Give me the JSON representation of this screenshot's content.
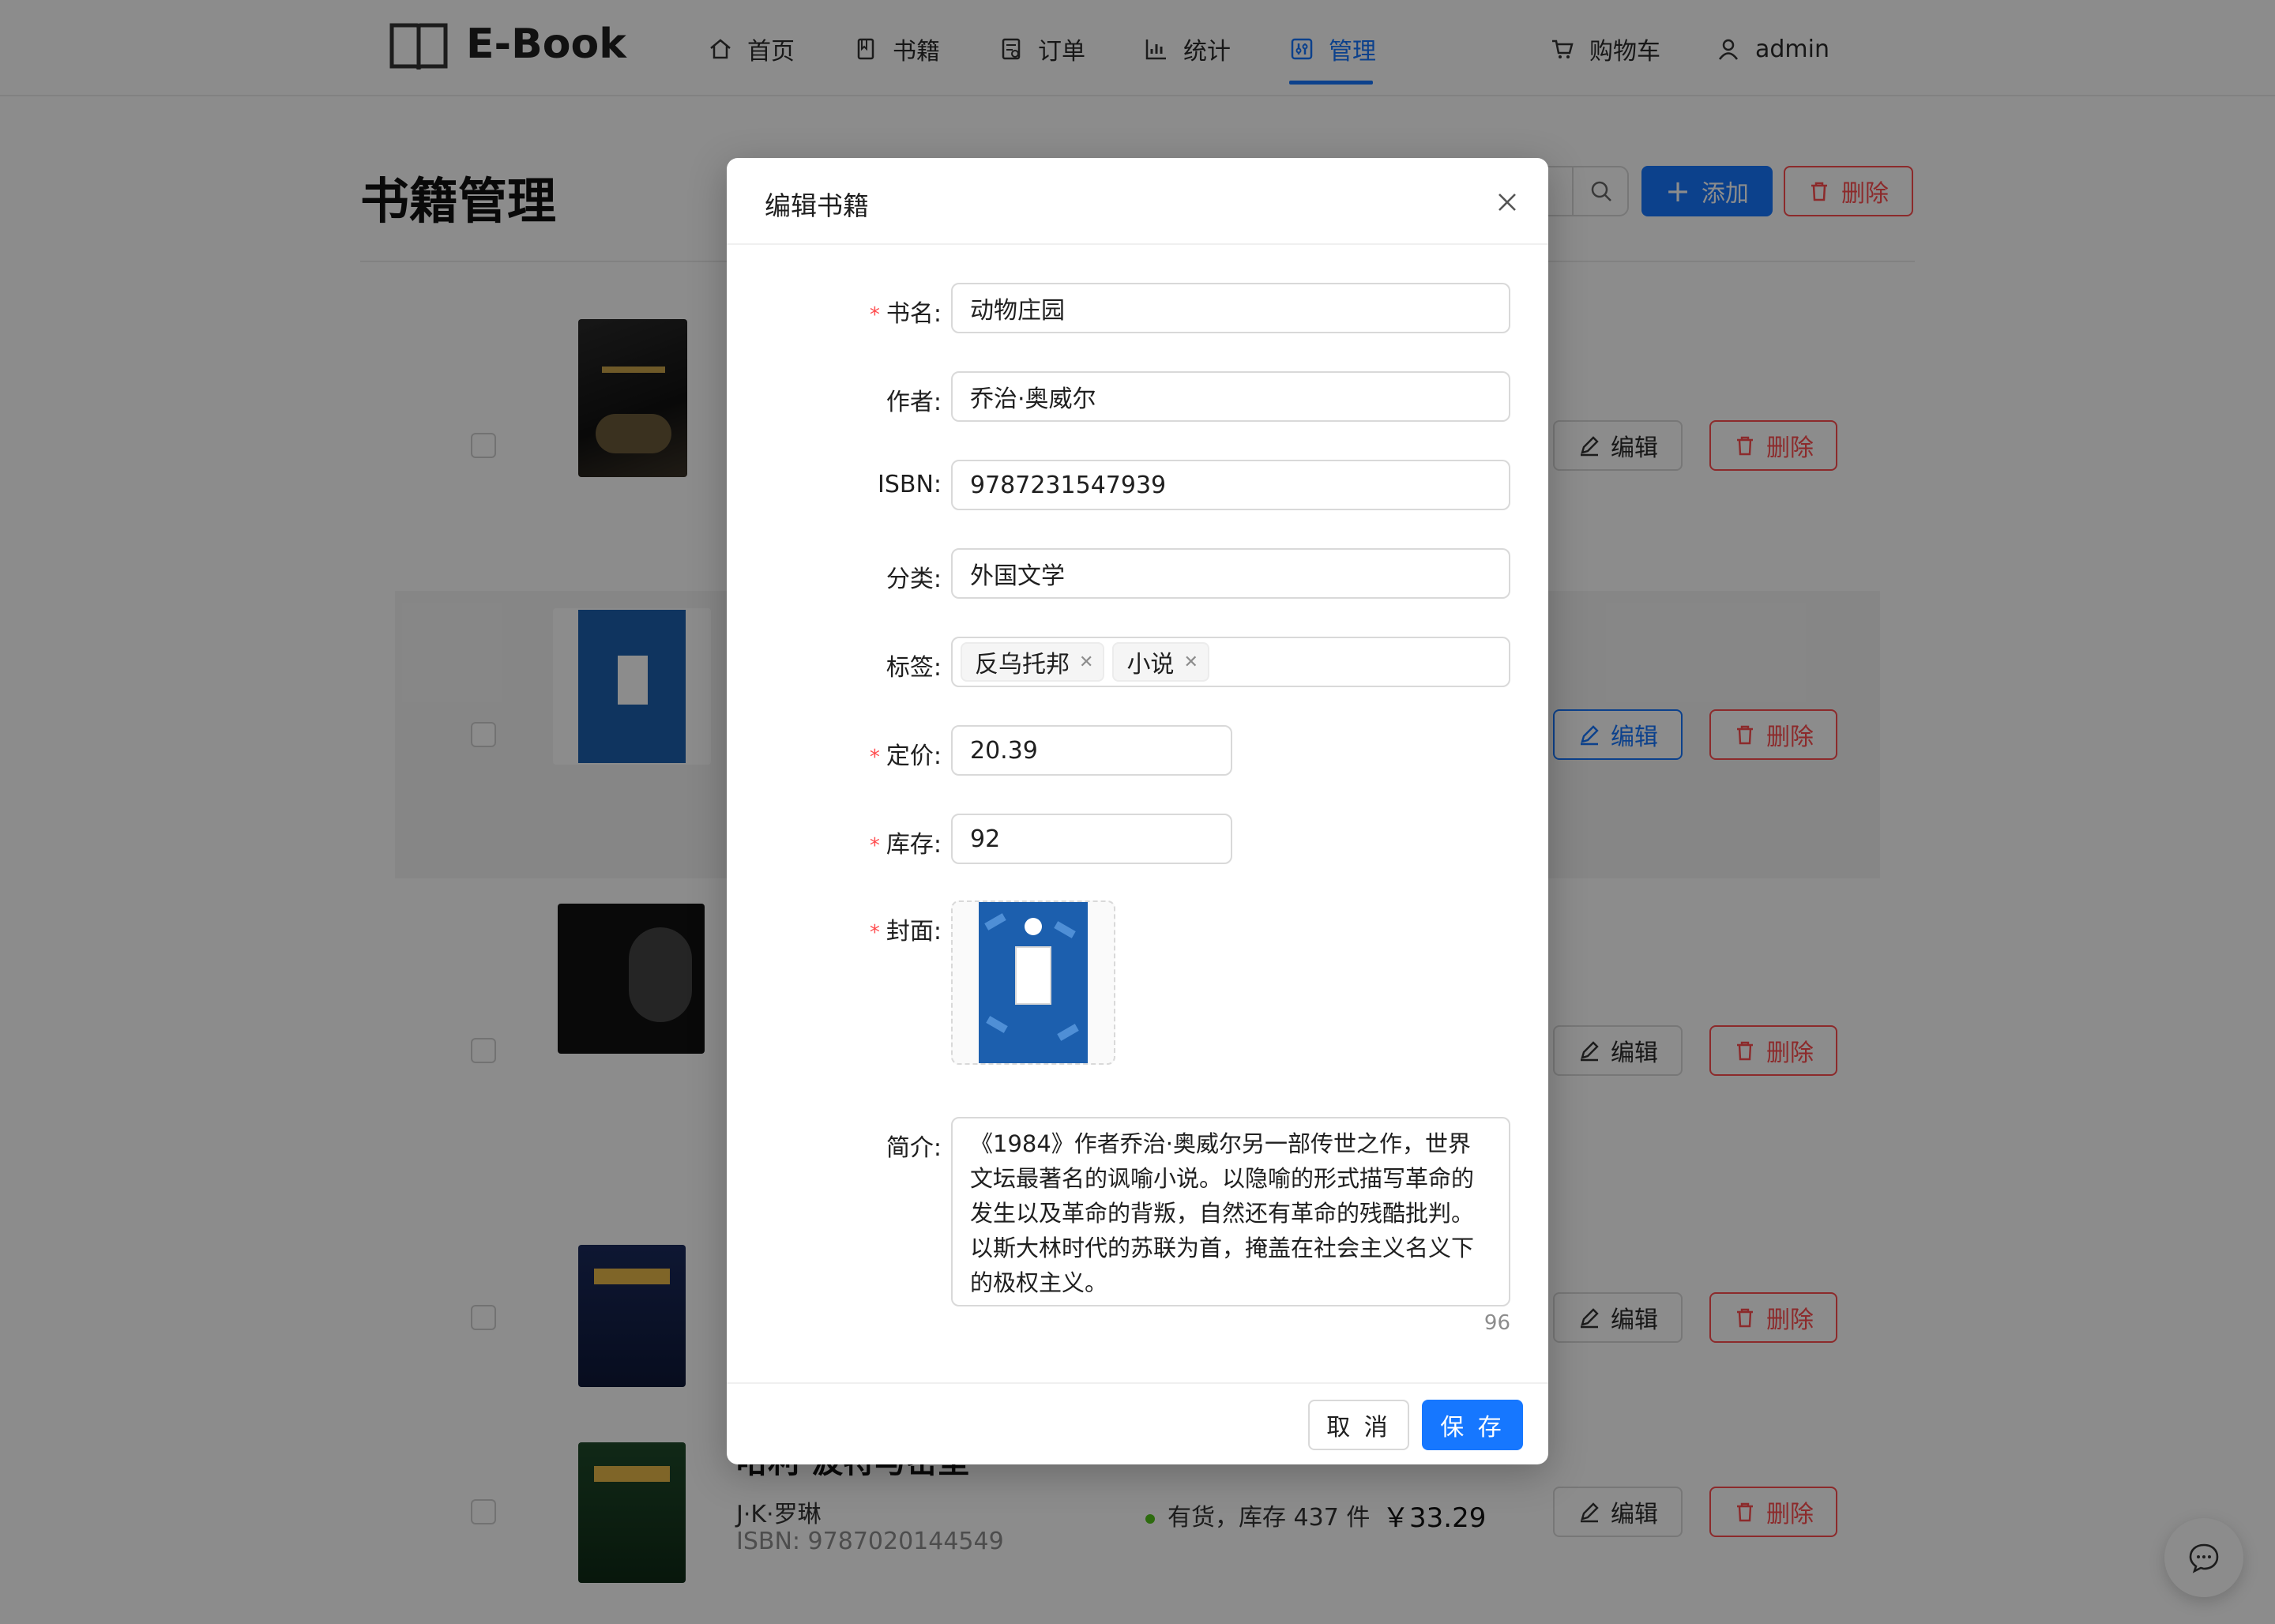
{
  "app": {
    "logo_text": "E-Book"
  },
  "nav": {
    "items": [
      {
        "label": "首页",
        "icon": "home-icon"
      },
      {
        "label": "书籍",
        "icon": "book-icon"
      },
      {
        "label": "订单",
        "icon": "order-icon"
      },
      {
        "label": "统计",
        "icon": "chart-icon"
      },
      {
        "label": "管理",
        "icon": "manage-icon",
        "active": true
      }
    ],
    "cart_label": "购物车",
    "user_label": "admin"
  },
  "page": {
    "title": "书籍管理",
    "add_label": "添加",
    "delete_label": "删除"
  },
  "rows": [
    {
      "edit_label": "编辑",
      "delete_label": "删除"
    },
    {
      "edit_label": "编辑",
      "delete_label": "删除",
      "highlighted": true
    },
    {
      "edit_label": "编辑",
      "delete_label": "删除"
    },
    {
      "edit_label": "编辑",
      "delete_label": "删除"
    },
    {
      "title": "哈利·波特与密室",
      "author": "J·K·罗琳",
      "isbn": "ISBN: 9787020144549",
      "status": "有货，库存 437 件",
      "price": "￥33.29",
      "edit_label": "编辑",
      "delete_label": "删除"
    }
  ],
  "modal": {
    "title": "编辑书籍",
    "fields": {
      "name_label": "书名:",
      "name_value": "动物庄园",
      "author_label": "作者:",
      "author_value": "乔治·奥威尔",
      "isbn_label": "ISBN:",
      "isbn_value": "9787231547939",
      "category_label": "分类:",
      "category_value": "外国文学",
      "tags_label": "标签:",
      "tags": [
        "反乌托邦",
        "小说"
      ],
      "price_label": "定价:",
      "price_value": "20.39",
      "stock_label": "库存:",
      "stock_value": "92",
      "cover_label": "封面:",
      "intro_label": "简介:",
      "intro_value": "《1984》作者乔治·奥威尔另一部传世之作，世界文坛最著名的讽喻小说。以隐喻的形式描写革命的发生以及革命的背叛，自然还有革命的残酷批判。以斯大林时代的苏联为首，掩盖在社会主义名义下的极权主义。",
      "intro_count": "96"
    },
    "cancel_label": "取 消",
    "save_label": "保 存"
  },
  "colors": {
    "primary": "#1677ff",
    "danger": "#ff4d4f",
    "success": "#52c41a"
  }
}
